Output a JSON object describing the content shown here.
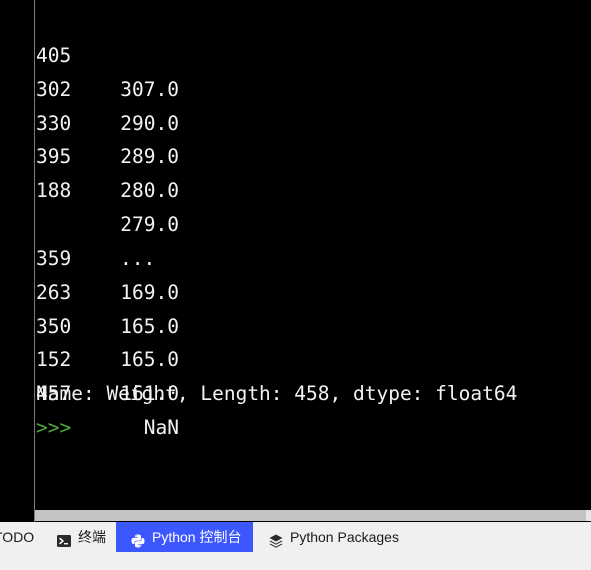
{
  "console": {
    "rows": [
      {
        "index": "405",
        "value": "307.0"
      },
      {
        "index": "302",
        "value": "290.0"
      },
      {
        "index": "330",
        "value": "289.0"
      },
      {
        "index": "395",
        "value": "280.0"
      },
      {
        "index": "188",
        "value": "279.0"
      },
      {
        "index": "",
        "value": "..."
      },
      {
        "index": "359",
        "value": "169.0"
      },
      {
        "index": "263",
        "value": "165.0"
      },
      {
        "index": "350",
        "value": "165.0"
      },
      {
        "index": "152",
        "value": "161.0"
      },
      {
        "index": "457",
        "value": "NaN"
      }
    ],
    "series_info": "Name: Weight, Length: 458, dtype: float64",
    "prompt": ">>>"
  },
  "tabs": {
    "todo": "TODO",
    "terminal": "终端",
    "python_console": "Python 控制台",
    "python_packages": "Python Packages"
  },
  "colors": {
    "background": "#000000",
    "text": "#f2f2f2",
    "prompt": "#4fa83a",
    "active_tab": "#3d57ff"
  },
  "icons": {
    "terminal": "terminal-icon",
    "python_console": "python-icon",
    "python_packages": "layers-icon"
  }
}
